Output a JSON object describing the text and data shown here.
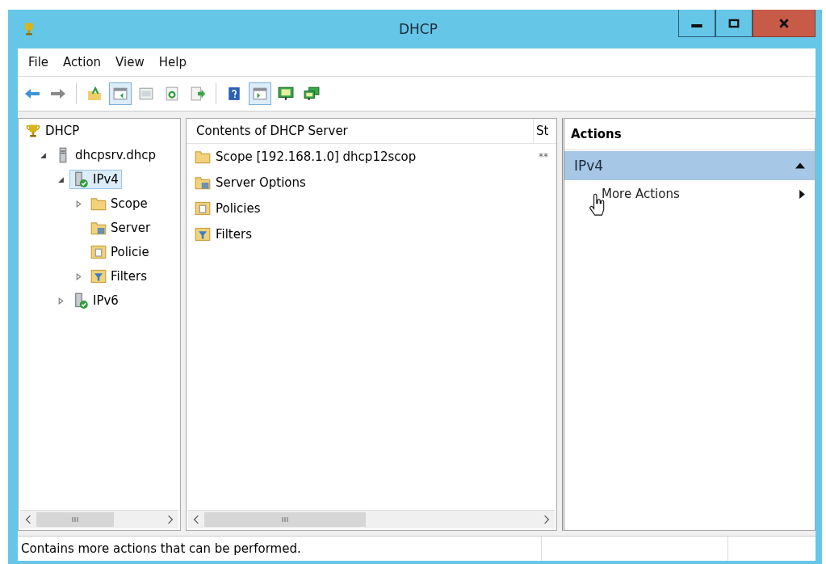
{
  "window": {
    "title": "DHCP"
  },
  "menu": [
    "File",
    "Action",
    "View",
    "Help"
  ],
  "toolbar": [
    {
      "kind": "back"
    },
    {
      "kind": "forward"
    },
    {
      "kind": "sep"
    },
    {
      "kind": "up",
      "selected": false
    },
    {
      "kind": "console-tree",
      "selected": true
    },
    {
      "kind": "properties",
      "selected": false
    },
    {
      "kind": "refresh",
      "selected": false
    },
    {
      "kind": "export",
      "selected": false
    },
    {
      "kind": "sep"
    },
    {
      "kind": "help",
      "selected": false
    },
    {
      "kind": "action-pane",
      "selected": true
    },
    {
      "kind": "monitor",
      "selected": false
    },
    {
      "kind": "monitors",
      "selected": false
    }
  ],
  "tree": [
    {
      "label": "DHCP",
      "kind": "trophy",
      "selected": false,
      "children": [
        {
          "label": "dhcpsrv.dhcp",
          "kind": "server",
          "expanded": true,
          "selected": false,
          "children": [
            {
              "label": "IPv4",
              "kind": "server-check",
              "expanded": true,
              "selected": true,
              "children": [
                {
                  "label": "Scope",
                  "kind": "folder",
                  "expanded": false,
                  "selected": false
                },
                {
                  "label": "Server",
                  "kind": "options",
                  "selected": false
                },
                {
                  "label": "Policie",
                  "kind": "policies",
                  "selected": false
                },
                {
                  "label": "Filters",
                  "kind": "filter",
                  "expanded": false,
                  "selected": false
                }
              ]
            },
            {
              "label": "IPv6",
              "kind": "server-check",
              "expanded": false,
              "selected": false
            }
          ]
        }
      ]
    }
  ],
  "list": {
    "columns": [
      "Contents of DHCP Server",
      "St"
    ],
    "rows": [
      {
        "kind": "folder",
        "name": "Scope [192.168.1.0] dhcp12scop",
        "column_2": "**"
      },
      {
        "kind": "options",
        "name": "Server Options"
      },
      {
        "kind": "policies",
        "name": "Policies"
      },
      {
        "kind": "filter",
        "name": "Filters"
      }
    ]
  },
  "actions": {
    "title": "Actions",
    "groups": [
      {
        "label": "IPv4",
        "expanded": true,
        "items": [
          {
            "label": "More Actions"
          }
        ]
      }
    ]
  },
  "status_bar": "Contains more actions that can be performed."
}
